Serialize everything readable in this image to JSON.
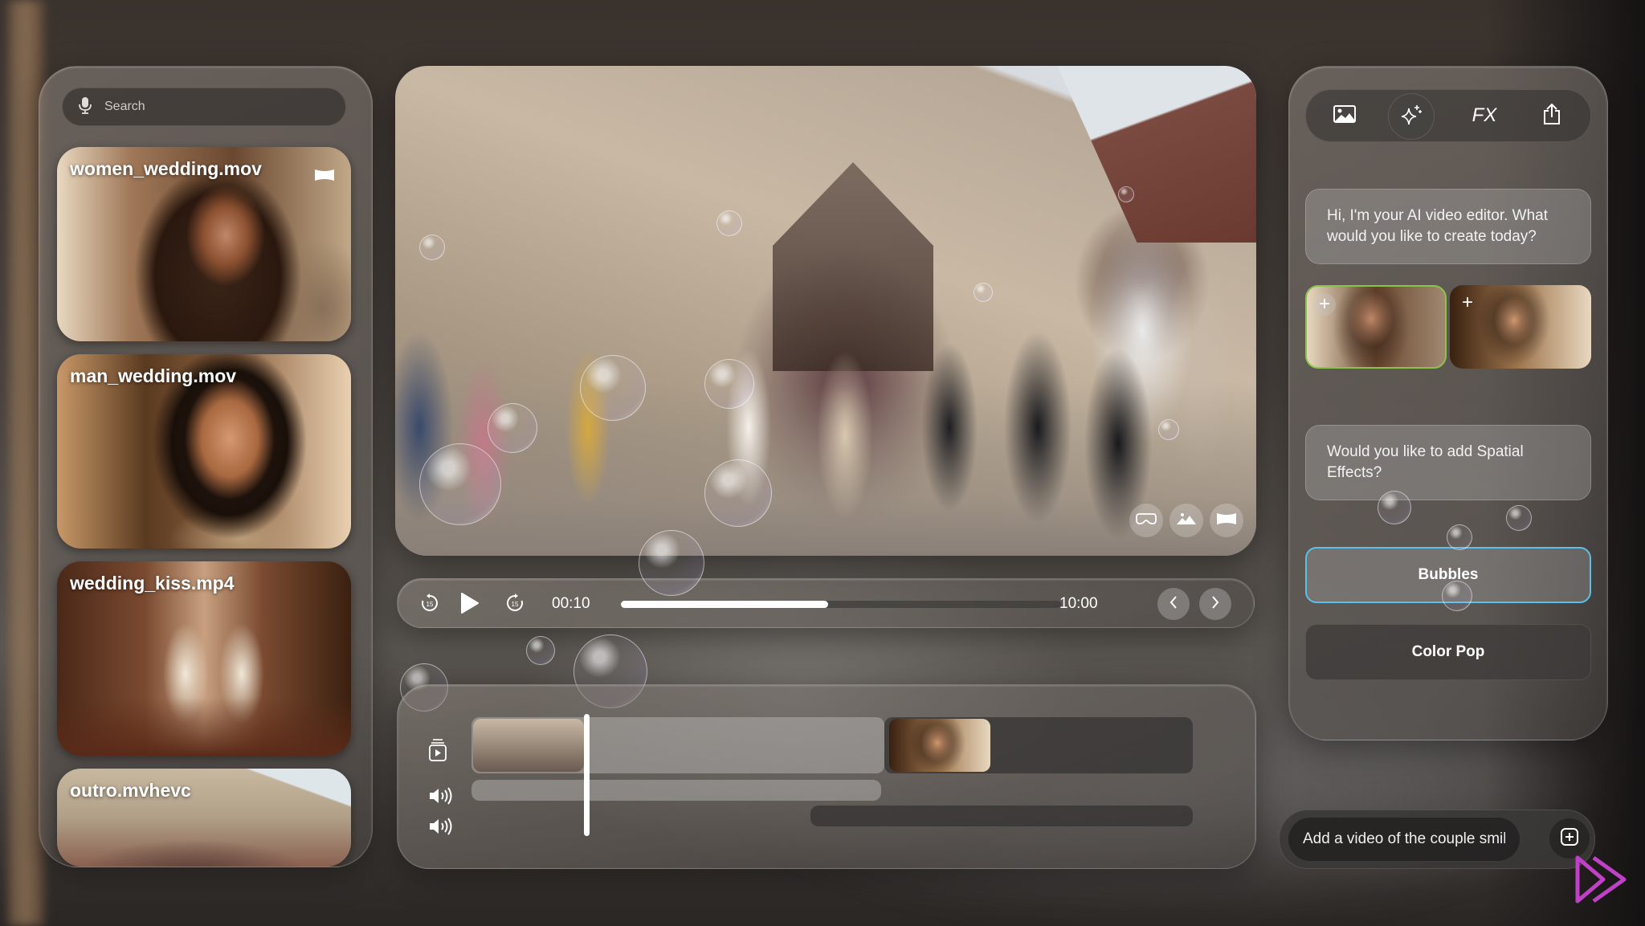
{
  "library": {
    "search": {
      "placeholder": "Search",
      "icon": "microphone-icon"
    },
    "clips": [
      {
        "title": "women_wedding.mov",
        "badge_icon": "spatial-video-icon"
      },
      {
        "title": "man_wedding.mov"
      },
      {
        "title": "wedding_kiss.mp4"
      },
      {
        "title": "outro.mvhevc"
      }
    ]
  },
  "player": {
    "view_controls": [
      "immersive-headset-icon",
      "photo-mountains-icon",
      "panorama-icon"
    ],
    "current_time": "00:10",
    "total_time": "10:00",
    "progress_fraction": 0.47,
    "skip_back_label": "15",
    "skip_forward_label": "15"
  },
  "timeline": {
    "track_icons": [
      "video-stack-icon",
      "speaker-wave-icon",
      "speaker-wave-icon"
    ],
    "clips": [
      "church_exit_clip",
      "man_smiling_clip"
    ]
  },
  "ai_panel": {
    "toolbar": {
      "image_icon": "image-icon",
      "sparkle_icon": "sparkles-icon",
      "fx_label": "FX",
      "share_icon": "share-icon"
    },
    "messages": [
      "Hi, I'm your AI video editor. What would you like to create today?",
      "Would you like to add Spatial Effects?"
    ],
    "attachments": [
      {
        "name": "women_wedding",
        "selected": true,
        "accent": "#8bc34a"
      },
      {
        "name": "man_wedding",
        "selected": false
      }
    ],
    "options": [
      {
        "label": "Bubbles",
        "selected": true,
        "accent": "#5bc0e8"
      },
      {
        "label": "Color Pop",
        "selected": false
      }
    ]
  },
  "prompt": {
    "value": "Add a video of the couple smilin",
    "add_icon": "plus-square-icon"
  },
  "brand": {
    "logo_color": "#c040c8"
  }
}
